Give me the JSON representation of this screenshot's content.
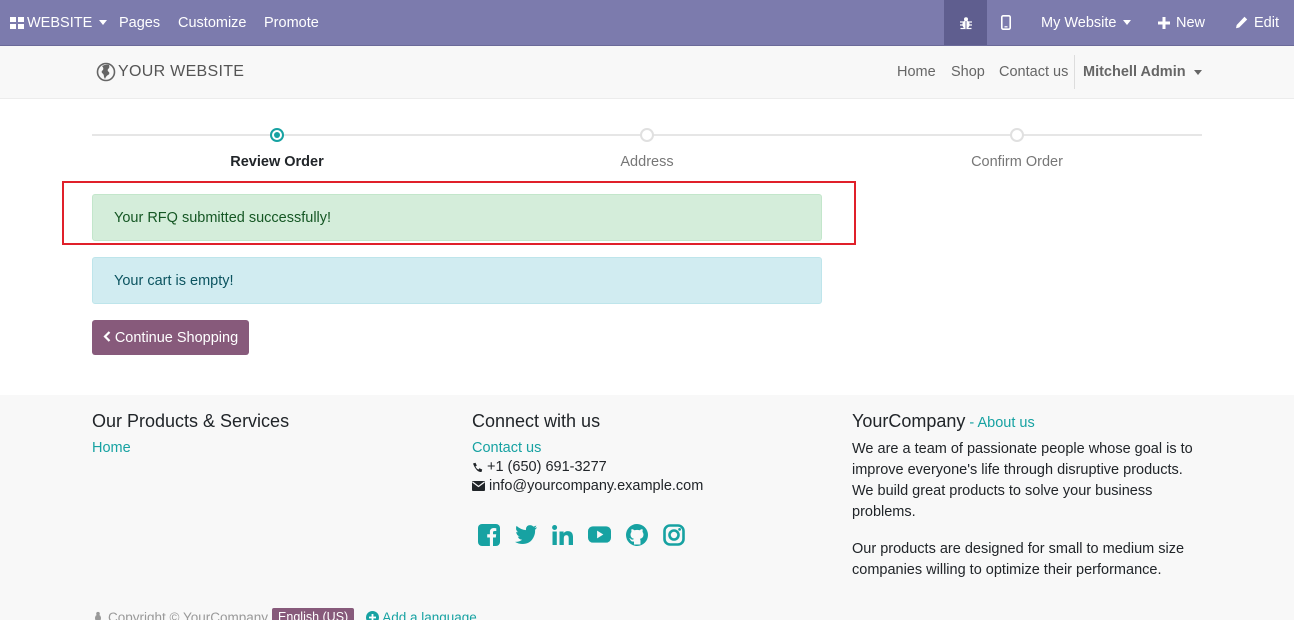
{
  "topbar": {
    "website_menu": "WEBSITE",
    "pages": "Pages",
    "customize": "Customize",
    "promote": "Promote",
    "my_website": "My Website",
    "new": "New",
    "edit": "Edit"
  },
  "header": {
    "logo": "YOUR WEBSITE",
    "nav": [
      "Home",
      "Shop",
      "Contact us"
    ],
    "user": "Mitchell Admin"
  },
  "steps": [
    "Review Order",
    "Address",
    "Confirm Order"
  ],
  "alerts": {
    "success": "Your RFQ submitted successfully!",
    "info": "Your cart is empty!"
  },
  "continue_button": "Continue Shopping",
  "footer": {
    "col1": {
      "title": "Our Products & Services",
      "link": "Home"
    },
    "col2": {
      "title": "Connect with us",
      "contact": "Contact us",
      "phone": "+1 (650) 691-3277",
      "email": "info@yourcompany.example.com"
    },
    "col3": {
      "company": "YourCompany",
      "separator": " - ",
      "about": "About us",
      "text1": "We are a team of passionate people whose goal is to improve everyone's life through disruptive products. We build great products to solve your business problems.",
      "text2": "Our products are designed for small to medium size companies willing to optimize their performance."
    },
    "social_icons": [
      "facebook-icon",
      "twitter-icon",
      "linkedin-icon",
      "youtube-icon",
      "github-icon",
      "instagram-icon"
    ],
    "copyright": "Copyright © YourCompany",
    "language": "English (US)",
    "add_language": "Add a language"
  },
  "colors": {
    "admin_bar": "#7c7bad",
    "primary": "#875a7b",
    "accent": "#17a2a2",
    "highlight_box": "#e0202a"
  }
}
